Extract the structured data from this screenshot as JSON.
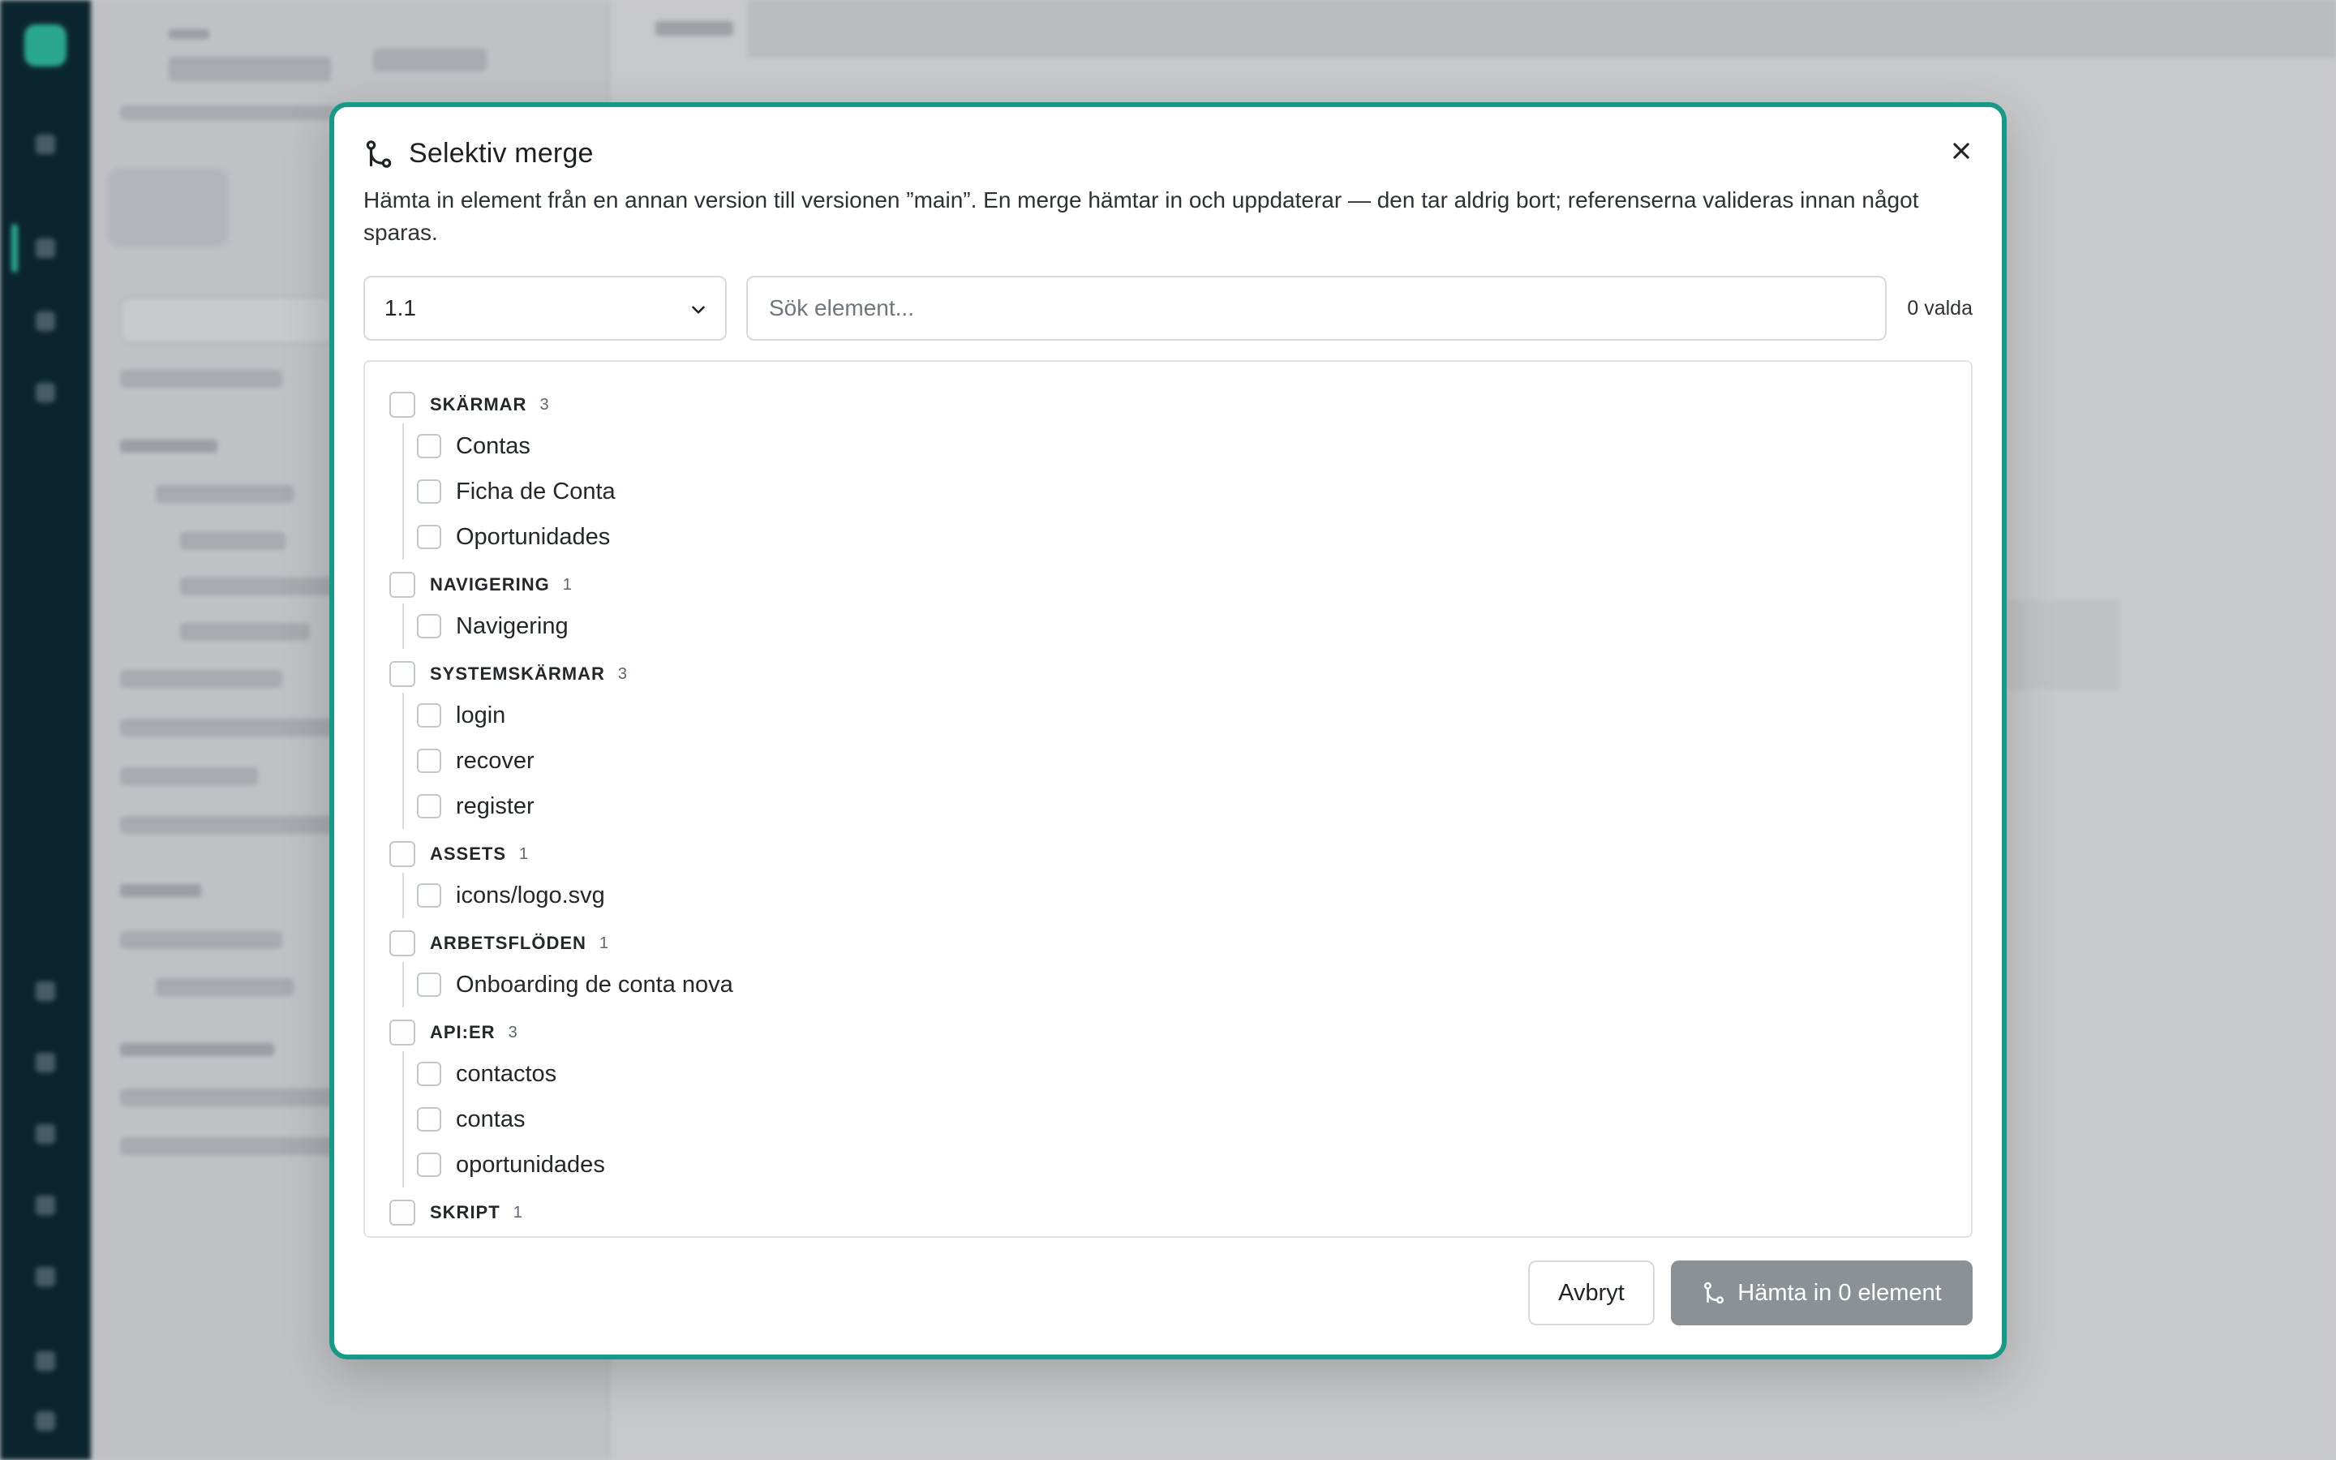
{
  "dialog": {
    "title": "Selektiv merge",
    "description": "Hämta in element från en annan version till versionen ”main”. En merge hämtar in och uppdaterar — den tar aldrig bort; referenserna valideras innan något sparas.",
    "version_select": {
      "value": "1.1"
    },
    "search": {
      "placeholder": "Sök element..."
    },
    "selected_count": "0 valda",
    "groups": [
      {
        "label": "SKÄRMAR",
        "count": "3",
        "items": [
          "Contas",
          "Ficha de Conta",
          "Oportunidades"
        ]
      },
      {
        "label": "NAVIGERING",
        "count": "1",
        "items": [
          "Navigering"
        ]
      },
      {
        "label": "SYSTEMSKÄRMAR",
        "count": "3",
        "items": [
          "login",
          "recover",
          "register"
        ]
      },
      {
        "label": "ASSETS",
        "count": "1",
        "items": [
          "icons/logo.svg"
        ]
      },
      {
        "label": "ARBETSFLÖDEN",
        "count": "1",
        "items": [
          "Onboarding de conta nova"
        ]
      },
      {
        "label": "API:ER",
        "count": "3",
        "items": [
          "contactos",
          "contas",
          "oportunidades"
        ]
      },
      {
        "label": "SKRIPT",
        "count": "1",
        "items": []
      }
    ],
    "footer": {
      "cancel_label": "Avbryt",
      "confirm_label": "Hämta in 0 element"
    },
    "accent_color": "#159a88"
  }
}
